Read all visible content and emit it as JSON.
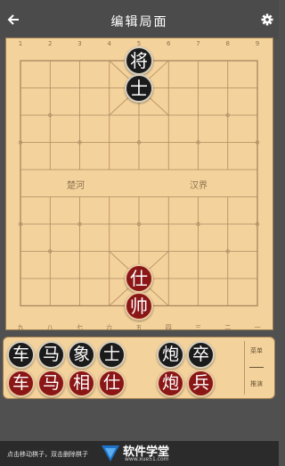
{
  "header": {
    "title": "编辑局面",
    "back_icon": "arrow-left-icon",
    "settings_icon": "gear-icon"
  },
  "board": {
    "top_numbers": [
      "1",
      "2",
      "3",
      "4",
      "5",
      "6",
      "7",
      "8",
      "9"
    ],
    "bottom_numbers": [
      "九",
      "八",
      "七",
      "六",
      "五",
      "四",
      "三",
      "二",
      "一"
    ],
    "river_left": "楚河",
    "river_right": "汉界",
    "pieces": [
      {
        "char": "将",
        "color": "black",
        "file": 5,
        "rank": 1
      },
      {
        "char": "士",
        "color": "black",
        "file": 5,
        "rank": 2
      },
      {
        "char": "仕",
        "color": "red",
        "file": 5,
        "rank": 9
      },
      {
        "char": "帅",
        "color": "red",
        "file": 5,
        "rank": 10
      }
    ]
  },
  "tray": {
    "black_pieces": [
      "车",
      "马",
      "象",
      "士",
      "炮",
      "卒"
    ],
    "red_pieces": [
      "车",
      "马",
      "相",
      "仕",
      "炮",
      "兵"
    ],
    "side_top": "菜单",
    "side_bottom": "推演"
  },
  "footer": {
    "hint": "点击移动棋子，双击删除棋子",
    "watermark_title": "软件学堂",
    "watermark_url": "www.xue51.com"
  },
  "colors": {
    "board": "#f4d29b",
    "grid_line": "#b08a63",
    "black_piece": "#1b1b1b",
    "red_piece": "#8a1616"
  }
}
